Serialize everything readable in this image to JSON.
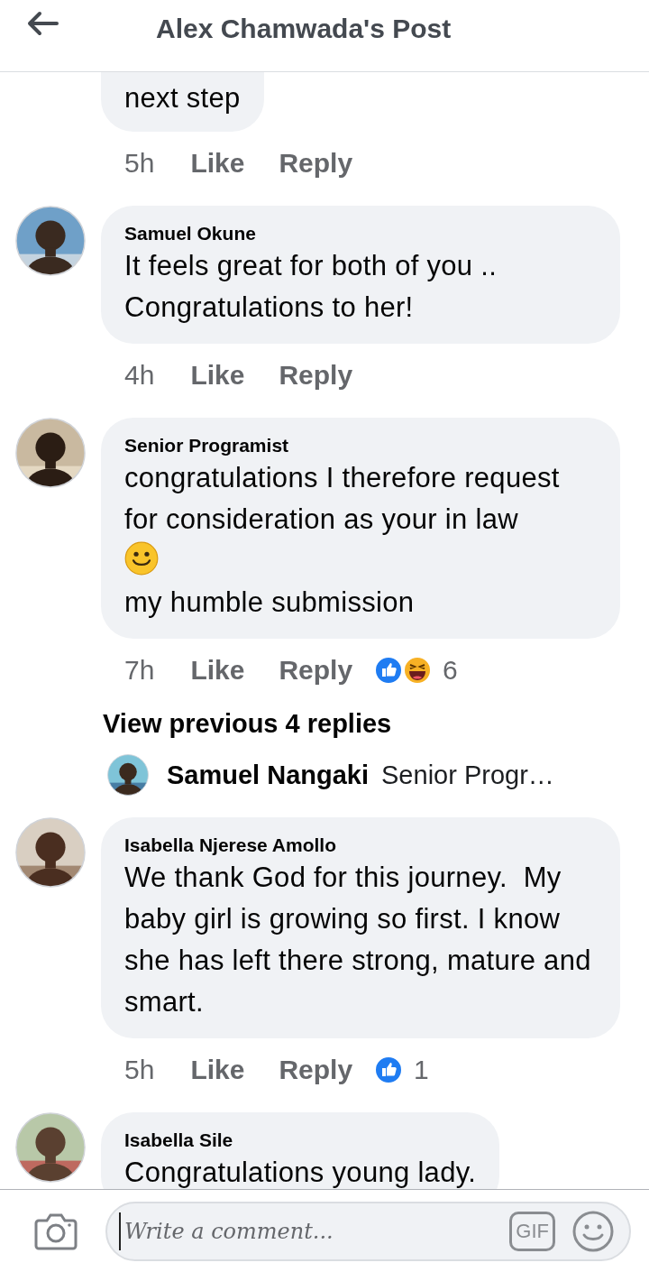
{
  "header": {
    "title": "Alex Chamwada's Post"
  },
  "comments": [
    {
      "body": [
        {
          "kind": "text",
          "text": "next step"
        }
      ],
      "time": "5h",
      "like": "Like",
      "reply": "Reply"
    },
    {
      "author": "Samuel Okune",
      "body": [
        {
          "kind": "text",
          "text": "It feels great for both of you .. Congratulations to her!"
        }
      ],
      "time": "4h",
      "like": "Like",
      "reply": "Reply"
    },
    {
      "author": "Senior Programist",
      "body": [
        {
          "kind": "text",
          "text": "congratulations I therefore request for consideration as your in law"
        },
        {
          "kind": "emoji"
        },
        {
          "kind": "text",
          "text": "my humble submission"
        }
      ],
      "time": "7h",
      "like": "Like",
      "reply": "Reply",
      "reactions": {
        "icons": [
          {
            "kind": "like"
          },
          {
            "kind": "haha"
          }
        ],
        "count": "6"
      },
      "replies": {
        "more": "View previous 4 replies",
        "latest": {
          "author": "Samuel Nangaki",
          "text": "Senior Progr…"
        }
      }
    },
    {
      "author": "Isabella Njerese Amollo",
      "body": [
        {
          "kind": "text",
          "text": "We thank God for this journey.  My baby girl is growing so first. I know she has left there strong, mature and smart."
        }
      ],
      "time": "5h",
      "like": "Like",
      "reply": "Reply",
      "reactions": {
        "icons": [
          {
            "kind": "like"
          }
        ],
        "count": "1"
      }
    },
    {
      "author": "Isabella Sile",
      "body": [
        {
          "kind": "text",
          "text": "Congratulations young lady."
        }
      ]
    }
  ],
  "composer": {
    "placeholder": "Write a comment...",
    "gif": "GIF"
  }
}
